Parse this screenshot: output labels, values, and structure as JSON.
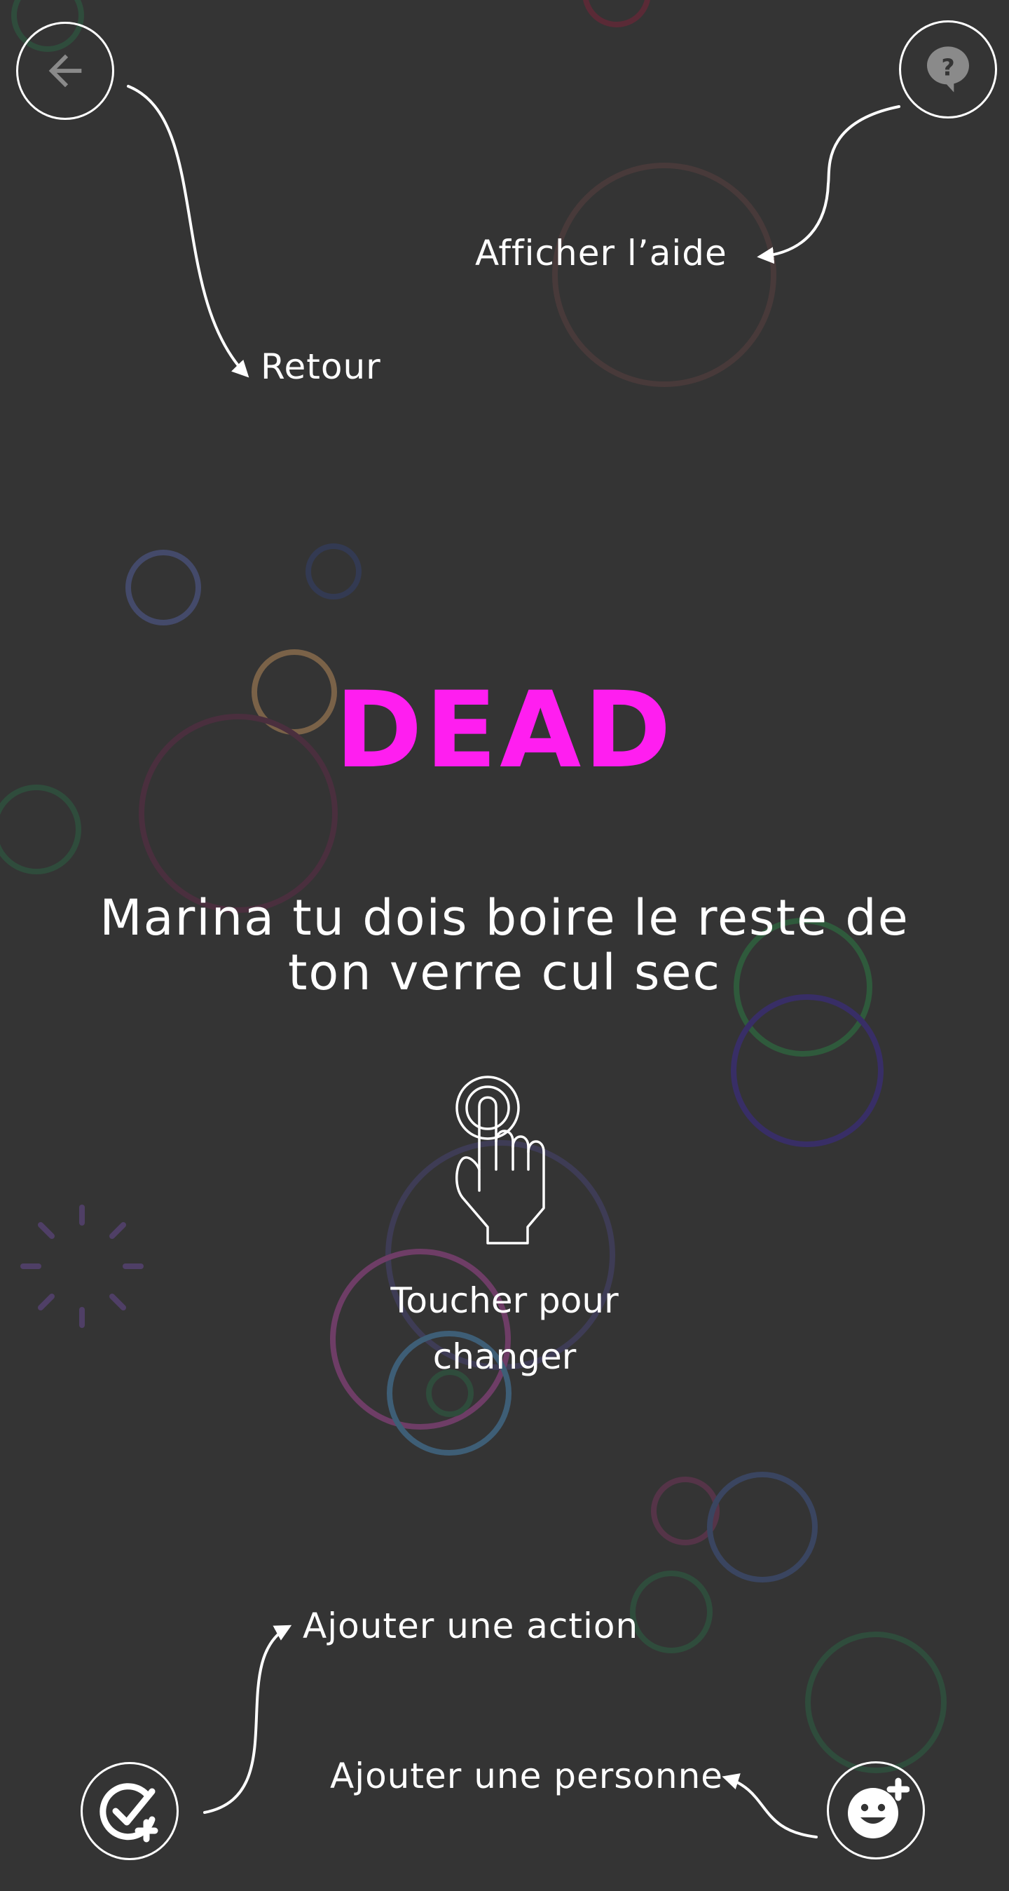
{
  "header": {
    "back_icon": "arrow-left-icon",
    "help_icon": "question-bubble-icon",
    "back_hint": "Retour",
    "help_hint": "Afficher l’aide"
  },
  "card": {
    "category": "DEAD",
    "category_color": "#ff1ef0",
    "message": "Marina tu dois boire le reste de ton verre cul sec",
    "tap_icon": "tap-finger-icon",
    "tap_hint": "Toucher pour changer"
  },
  "footer": {
    "add_action_icon": "check-plus-icon",
    "add_person_icon": "smiley-plus-icon",
    "add_action_hint": "Ajouter une action",
    "add_person_hint": "Ajouter une personne"
  },
  "colors": {
    "background": "#343434",
    "foreground": "#ffffff",
    "accent": "#ff1ef0"
  }
}
